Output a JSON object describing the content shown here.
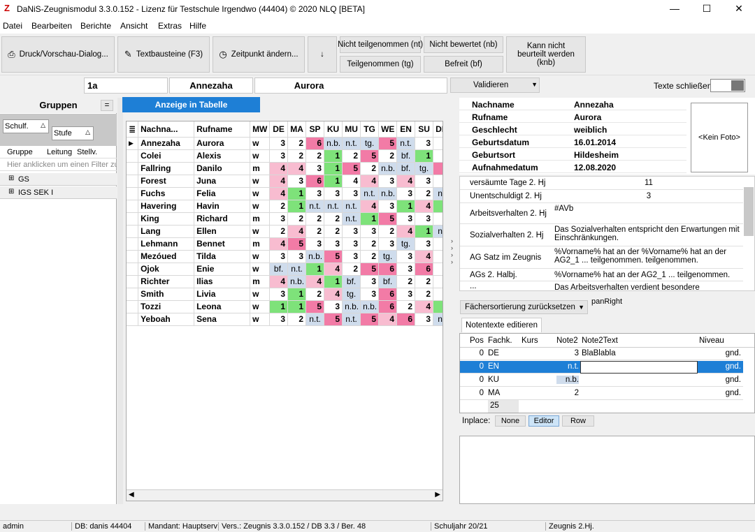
{
  "window": {
    "title": "DaNiS-Zeugnismodul 3.3.0.152 - Lizenz für Testschule Irgendwo (44404)      © 2020 NLQ   [BETA]",
    "logo": "Z",
    "min": "—",
    "max": "☐",
    "close": "✕"
  },
  "menu": [
    "Datei",
    "Bearbeiten",
    "Berichte",
    "Ansicht",
    "Extras",
    "Hilfe"
  ],
  "toolbar": {
    "print": "Druck/Vorschau-Dialog...",
    "textbausteine": "Textbausteine (F3)",
    "zeitpunkt": "Zeitpunkt ändern...",
    "arrow": "↓",
    "nt": "Nicht teilgenommen (nt)",
    "tg": "Teilgenommen (tg)",
    "nb": "Nicht bewertet (nb)",
    "bf": "Befreit (bf)",
    "knb": "Kann nicht beurteilt werden (knb)"
  },
  "namebar": {
    "klasse": "1a",
    "nachname": "Annezaha",
    "rufname": "Aurora",
    "validieren": "Validieren",
    "texte_schliessen": "Texte schließen"
  },
  "left": {
    "title": "Gruppen",
    "collapse": "=",
    "schulf": "Schulf.",
    "stufe": "Stufe",
    "col_gruppe": "Gruppe",
    "col_leitung": "Leitung",
    "col_stellv": "Stellv.",
    "filter": "Hier anklicken um einen Filter zu",
    "groups": [
      "GS",
      "IGS SEK I"
    ]
  },
  "anzeige_tab": "Anzeige in Tabelle",
  "grid": {
    "headers": [
      "Nachna...",
      "Rufname",
      "MW",
      "DE",
      "MA",
      "SP",
      "KU",
      "MU",
      "TG",
      "WE",
      "EN",
      "SU",
      "DE"
    ],
    "rows": [
      [
        "Annezaha",
        "Aurora",
        "w",
        "3",
        "2",
        "6",
        "n.b.",
        "n.t.",
        "tg.",
        "5",
        "n.t.",
        "3",
        ""
      ],
      [
        "Colei",
        "Alexis",
        "w",
        "3",
        "2",
        "2",
        "1",
        "2",
        "5",
        "2",
        "bf.",
        "1",
        ""
      ],
      [
        "Fallring",
        "Danilo",
        "m",
        "4",
        "4",
        "3",
        "1",
        "5",
        "2",
        "n.b.",
        "bf.",
        "tg.",
        ""
      ],
      [
        "Forest",
        "Juna",
        "w",
        "4",
        "3",
        "6",
        "1",
        "4",
        "4",
        "3",
        "4",
        "3",
        ""
      ],
      [
        "Fuchs",
        "Felia",
        "w",
        "4",
        "1",
        "3",
        "3",
        "3",
        "n.t.",
        "n.b.",
        "3",
        "2",
        "n"
      ],
      [
        "Havering",
        "Havin",
        "w",
        "2",
        "1",
        "n.t.",
        "n.t.",
        "n.t.",
        "4",
        "3",
        "1",
        "4",
        ""
      ],
      [
        "King",
        "Richard",
        "m",
        "3",
        "2",
        "2",
        "2",
        "n.t.",
        "1",
        "5",
        "3",
        "3",
        ""
      ],
      [
        "Lang",
        "Ellen",
        "w",
        "2",
        "4",
        "2",
        "2",
        "3",
        "3",
        "2",
        "4",
        "1",
        "n"
      ],
      [
        "Lehmann",
        "Bennet",
        "m",
        "4",
        "5",
        "3",
        "3",
        "3",
        "2",
        "3",
        "tg.",
        "3",
        ""
      ],
      [
        "Mezóued",
        "Tilda",
        "w",
        "3",
        "3",
        "n.b.",
        "5",
        "3",
        "2",
        "tg.",
        "3",
        "4",
        ""
      ],
      [
        "Ojok",
        "Enie",
        "w",
        "bf.",
        "n.t.",
        "1",
        "4",
        "2",
        "5",
        "6",
        "3",
        "6",
        ""
      ],
      [
        "Richter",
        "Ilias",
        "m",
        "4",
        "n.b.",
        "4",
        "1",
        "bf.",
        "3",
        "bf.",
        "2",
        "2",
        ""
      ],
      [
        "Smith",
        "Livia",
        "w",
        "3",
        "1",
        "2",
        "4",
        "tg.",
        "3",
        "6",
        "3",
        "2",
        ""
      ],
      [
        "Tozzi",
        "Leona",
        "w",
        "1",
        "1",
        "5",
        "3",
        "n.b.",
        "n.b.",
        "6",
        "2",
        "4",
        ""
      ],
      [
        "Yeboah",
        "Sena",
        "w",
        "3",
        "2",
        "n.t.",
        "5",
        "n.t.",
        "5",
        "4",
        "6",
        "3",
        "n"
      ]
    ],
    "colors": [
      [
        "",
        "",
        "",
        "",
        "",
        "red",
        "",
        "",
        "",
        "red",
        "",
        "",
        ""
      ],
      [
        "",
        "",
        "",
        "",
        "",
        "",
        "green",
        "",
        "red",
        "",
        "",
        "green",
        ""
      ],
      [
        "",
        "",
        "",
        "pink",
        "pink",
        "",
        "green",
        "red",
        "",
        "",
        "",
        "",
        "red"
      ],
      [
        "",
        "",
        "",
        "pink",
        "",
        "red",
        "green",
        "",
        "pink",
        "",
        "pink",
        "",
        ""
      ],
      [
        "",
        "",
        "",
        "pink",
        "green",
        "",
        "",
        "",
        "",
        "",
        "",
        "",
        "blue"
      ],
      [
        "",
        "",
        "",
        "",
        "green",
        "",
        "",
        "",
        "pink",
        "",
        "green",
        "pink",
        "green"
      ],
      [
        "",
        "",
        "",
        "",
        "",
        "",
        "",
        "",
        "green",
        "red",
        "",
        "",
        ""
      ],
      [
        "",
        "",
        "",
        "",
        "pink",
        "",
        "",
        "",
        "",
        "",
        "pink",
        "green",
        "blue"
      ],
      [
        "",
        "",
        "",
        "pink",
        "red",
        "",
        "",
        "",
        "",
        "",
        "",
        "",
        ""
      ],
      [
        "",
        "",
        "",
        "",
        "",
        "",
        "red",
        "",
        "",
        "",
        "",
        "pink",
        ""
      ],
      [
        "",
        "",
        "",
        "",
        "",
        "green",
        "pink",
        "",
        "red",
        "red",
        "",
        "red",
        ""
      ],
      [
        "",
        "",
        "",
        "pink",
        "",
        "pink",
        "green",
        "",
        "",
        "",
        "",
        "",
        ""
      ],
      [
        "",
        "",
        "",
        "",
        "green",
        "",
        "pink",
        "",
        "",
        "red",
        "",
        "",
        ""
      ],
      [
        "",
        "",
        "",
        "green",
        "green",
        "red",
        "",
        "",
        "",
        "red",
        "",
        "pink",
        "green"
      ],
      [
        "",
        "",
        "",
        "",
        "",
        "",
        "red",
        "",
        "red",
        "pink",
        "red",
        "",
        "blue"
      ]
    ]
  },
  "info": {
    "rows": [
      [
        "Nachname",
        "Annezaha"
      ],
      [
        "Rufname",
        "Aurora"
      ],
      [
        "Geschlecht",
        "weiblich"
      ],
      [
        "Geburtsdatum",
        "16.01.2014"
      ],
      [
        "Geburtsort",
        "Hildesheim"
      ],
      [
        "Aufnahmedatum",
        "12.08.2020"
      ]
    ],
    "foto": "<Kein Foto>"
  },
  "props": [
    {
      "label": "versäumte Tage 2. Hj",
      "value": "11",
      "center": true
    },
    {
      "label": "Unentschuldigt 2. Hj",
      "value": "3",
      "center": true
    },
    {
      "label": "Arbeitsverhalten 2. Hj",
      "value": "#AVb"
    },
    {
      "label": "Sozialverhalten 2. Hj",
      "value": "Das Sozialverhalten entspricht den Erwartungen mit Einschränkungen."
    },
    {
      "label": "AG Satz im Zeugnis",
      "value": "%Vorname% hat an der %Vorname% hat an der AG2_1 ... teilgenommen. teilgenommen."
    },
    {
      "label": "AGs 2. Halbj.",
      "value": "%Vorname% hat an der AG2_1 ... teilgenommen."
    },
    {
      "label": "...",
      "value": "Das Arbeitsverhalten verdient besondere"
    }
  ],
  "fach_sort": "Fächersortierung zurücksetzen",
  "panright": "panRight",
  "notentexte_tab": "Notentexte editieren",
  "notes": {
    "headers": [
      "Pos",
      "Fachk.",
      "Kurs",
      "Note2",
      "Note2Text",
      "Niveau"
    ],
    "rows": [
      [
        "0",
        "DE",
        "",
        "3",
        "BlaBlabla",
        "gnd."
      ],
      [
        "0",
        "EN",
        "",
        "n.t.",
        "",
        "gnd."
      ],
      [
        "0",
        "KU",
        "",
        "n.b.",
        "",
        "gnd."
      ],
      [
        "0",
        "MA",
        "",
        "2",
        "",
        "gnd."
      ]
    ],
    "count": "25"
  },
  "inplace": {
    "label": "Inplace:",
    "none": "None",
    "editor": "Editor",
    "row": "Row"
  },
  "status": {
    "user": "admin",
    "db": "DB: danis  44404",
    "mandant": "Mandant: Hauptserv",
    "vers": "Vers.: Zeugnis 3.3.0.152 / DB 3.3 / Ber. 48",
    "schuljahr": "Schuljahr 20/21",
    "zeugnis": "Zeugnis 2.Hj."
  }
}
